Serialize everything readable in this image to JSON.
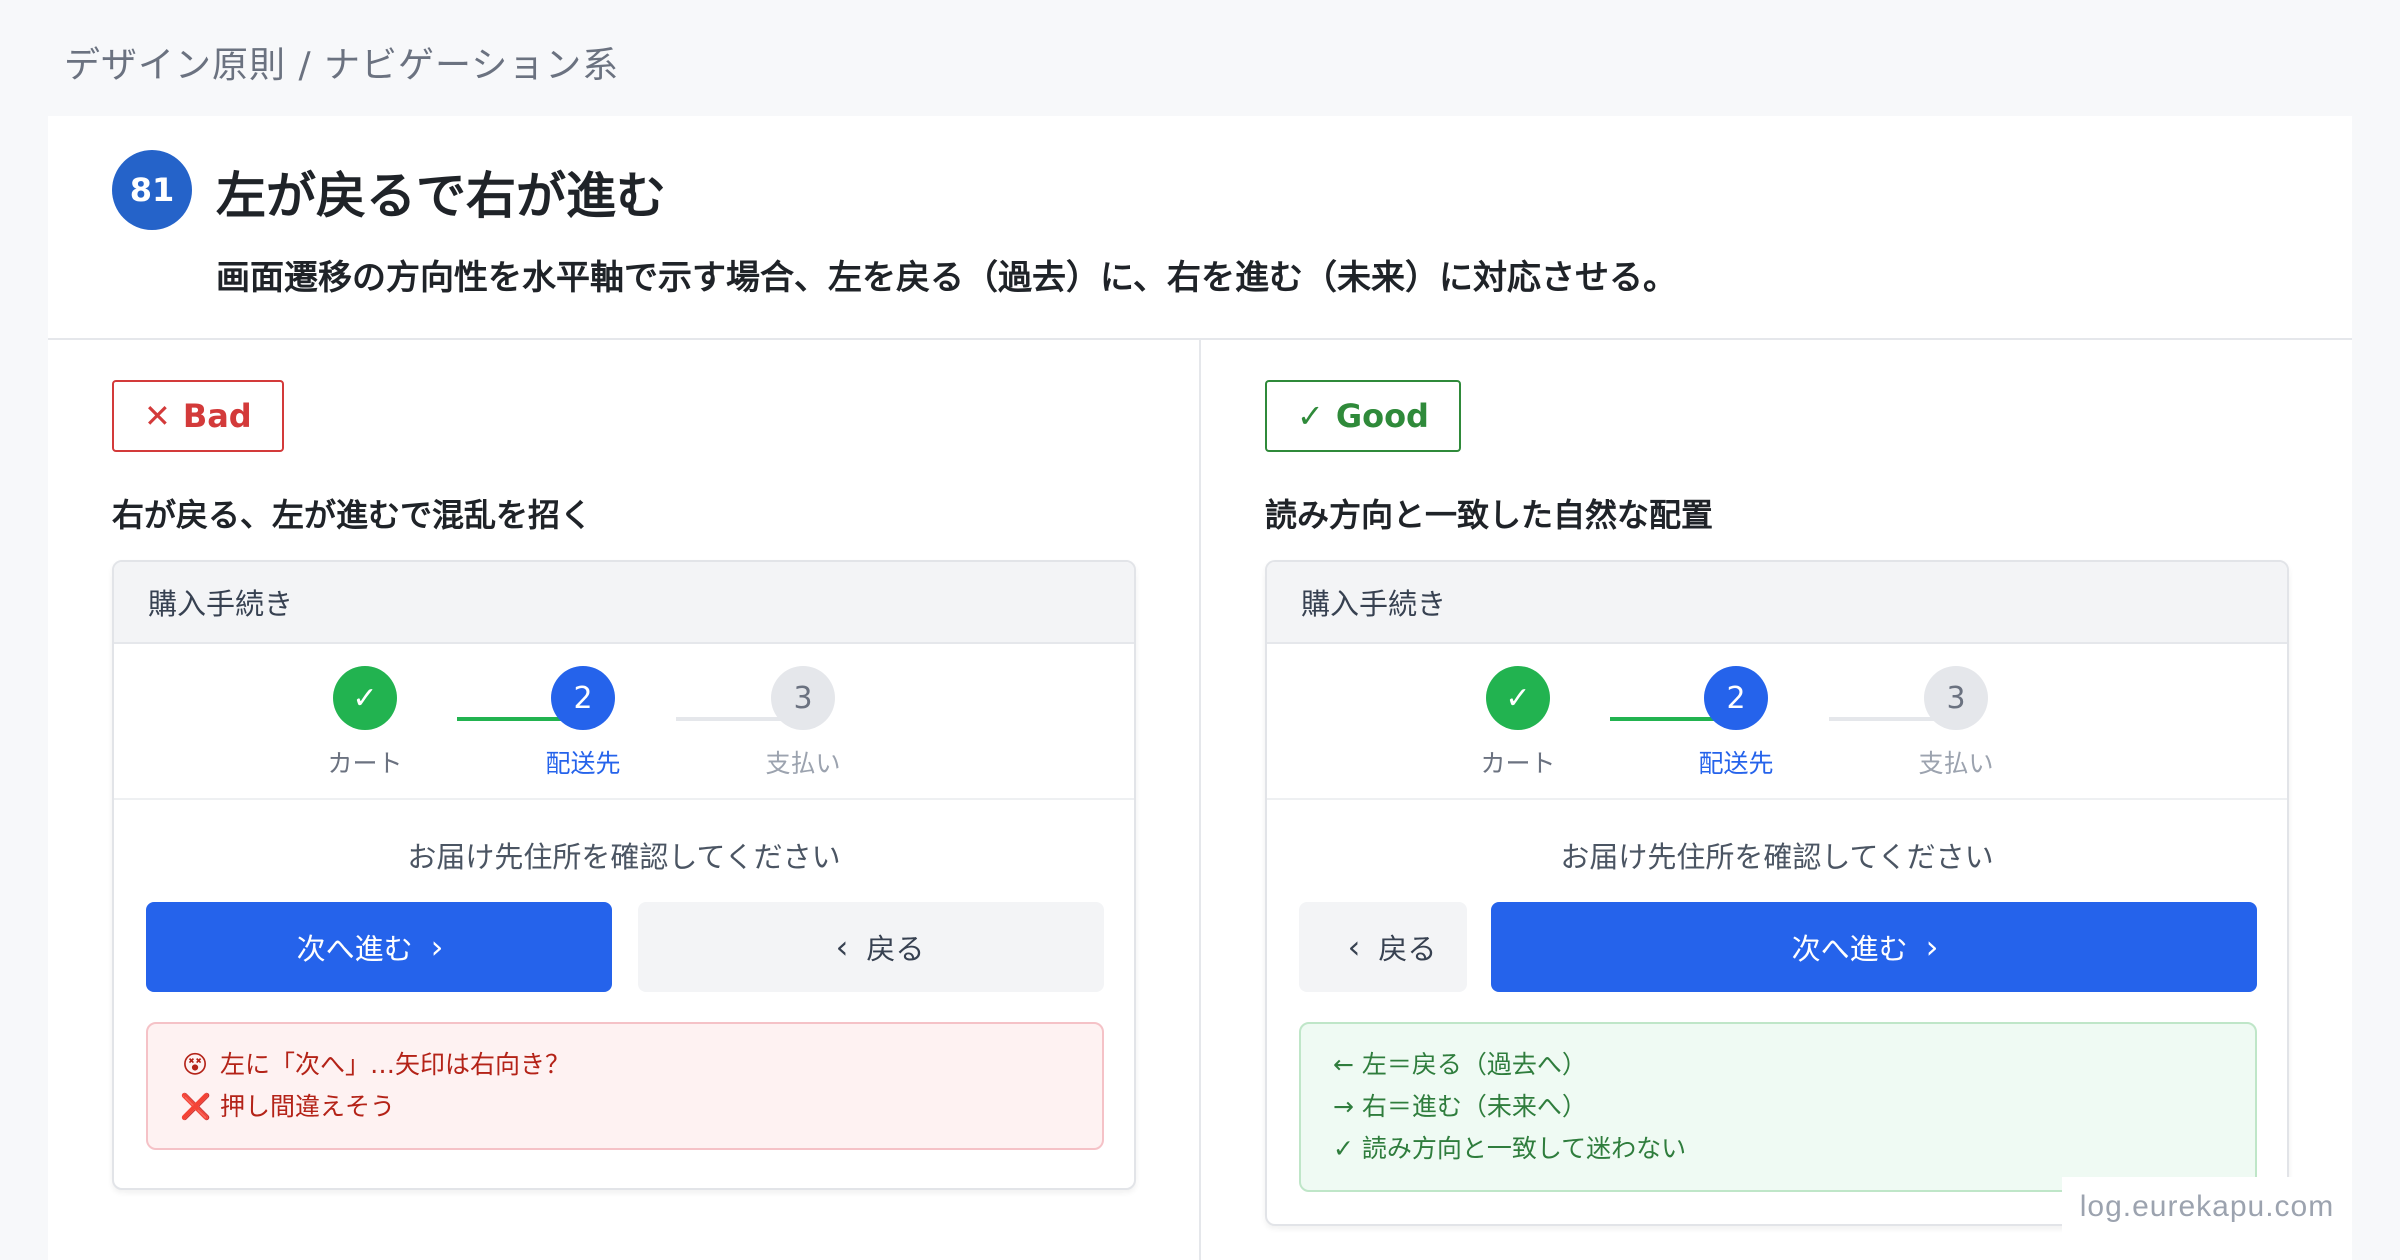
{
  "breadcrumb": "デザイン原則 / ナビゲーション系",
  "header": {
    "number": "81",
    "title": "左が戻るで右が進む",
    "subtitle": "画面遷移の方向性を水平軸で示す場合、左を戻る（過去）に、右を進む（未来）に対応させる。"
  },
  "bad": {
    "tag_icon": "✕",
    "tag_label": "Bad",
    "heading": "右が戻る、左が進むで混乱を招く",
    "mock": {
      "title": "購入手続き",
      "steps": [
        {
          "mark": "✓",
          "label": "カート",
          "state": "done"
        },
        {
          "mark": "2",
          "label": "配送先",
          "state": "active"
        },
        {
          "mark": "3",
          "label": "支払い",
          "state": "todo"
        }
      ],
      "prompt": "お届け先住所を確認してください",
      "next_label": "次へ進む",
      "next_arrow": "›",
      "back_label": "戻る",
      "back_arrow": "‹"
    },
    "note": [
      {
        "emoji": "😵",
        "text": "左に「次へ」…矢印は右向き？"
      },
      {
        "emoji": "❌",
        "text": "押し間違えそう"
      }
    ]
  },
  "good": {
    "tag_icon": "✓",
    "tag_label": "Good",
    "heading": "読み方向と一致した自然な配置",
    "mock": {
      "title": "購入手続き",
      "steps": [
        {
          "mark": "✓",
          "label": "カート",
          "state": "done"
        },
        {
          "mark": "2",
          "label": "配送先",
          "state": "active"
        },
        {
          "mark": "3",
          "label": "支払い",
          "state": "todo"
        }
      ],
      "prompt": "お届け先住所を確認してください",
      "back_label": "戻る",
      "back_arrow": "‹",
      "next_label": "次へ進む",
      "next_arrow": "›"
    },
    "note": [
      "← 左＝戻る（過去へ）",
      "→ 右＝進む（未来へ）",
      "✓ 読み方向と一致して迷わない"
    ]
  },
  "watermark": "log.eurekapu.com",
  "colors": {
    "primary": "#2563eb",
    "badge": "#2563c9",
    "done": "#22b350",
    "bad": "#d33a3a",
    "good": "#2f8a3a"
  }
}
